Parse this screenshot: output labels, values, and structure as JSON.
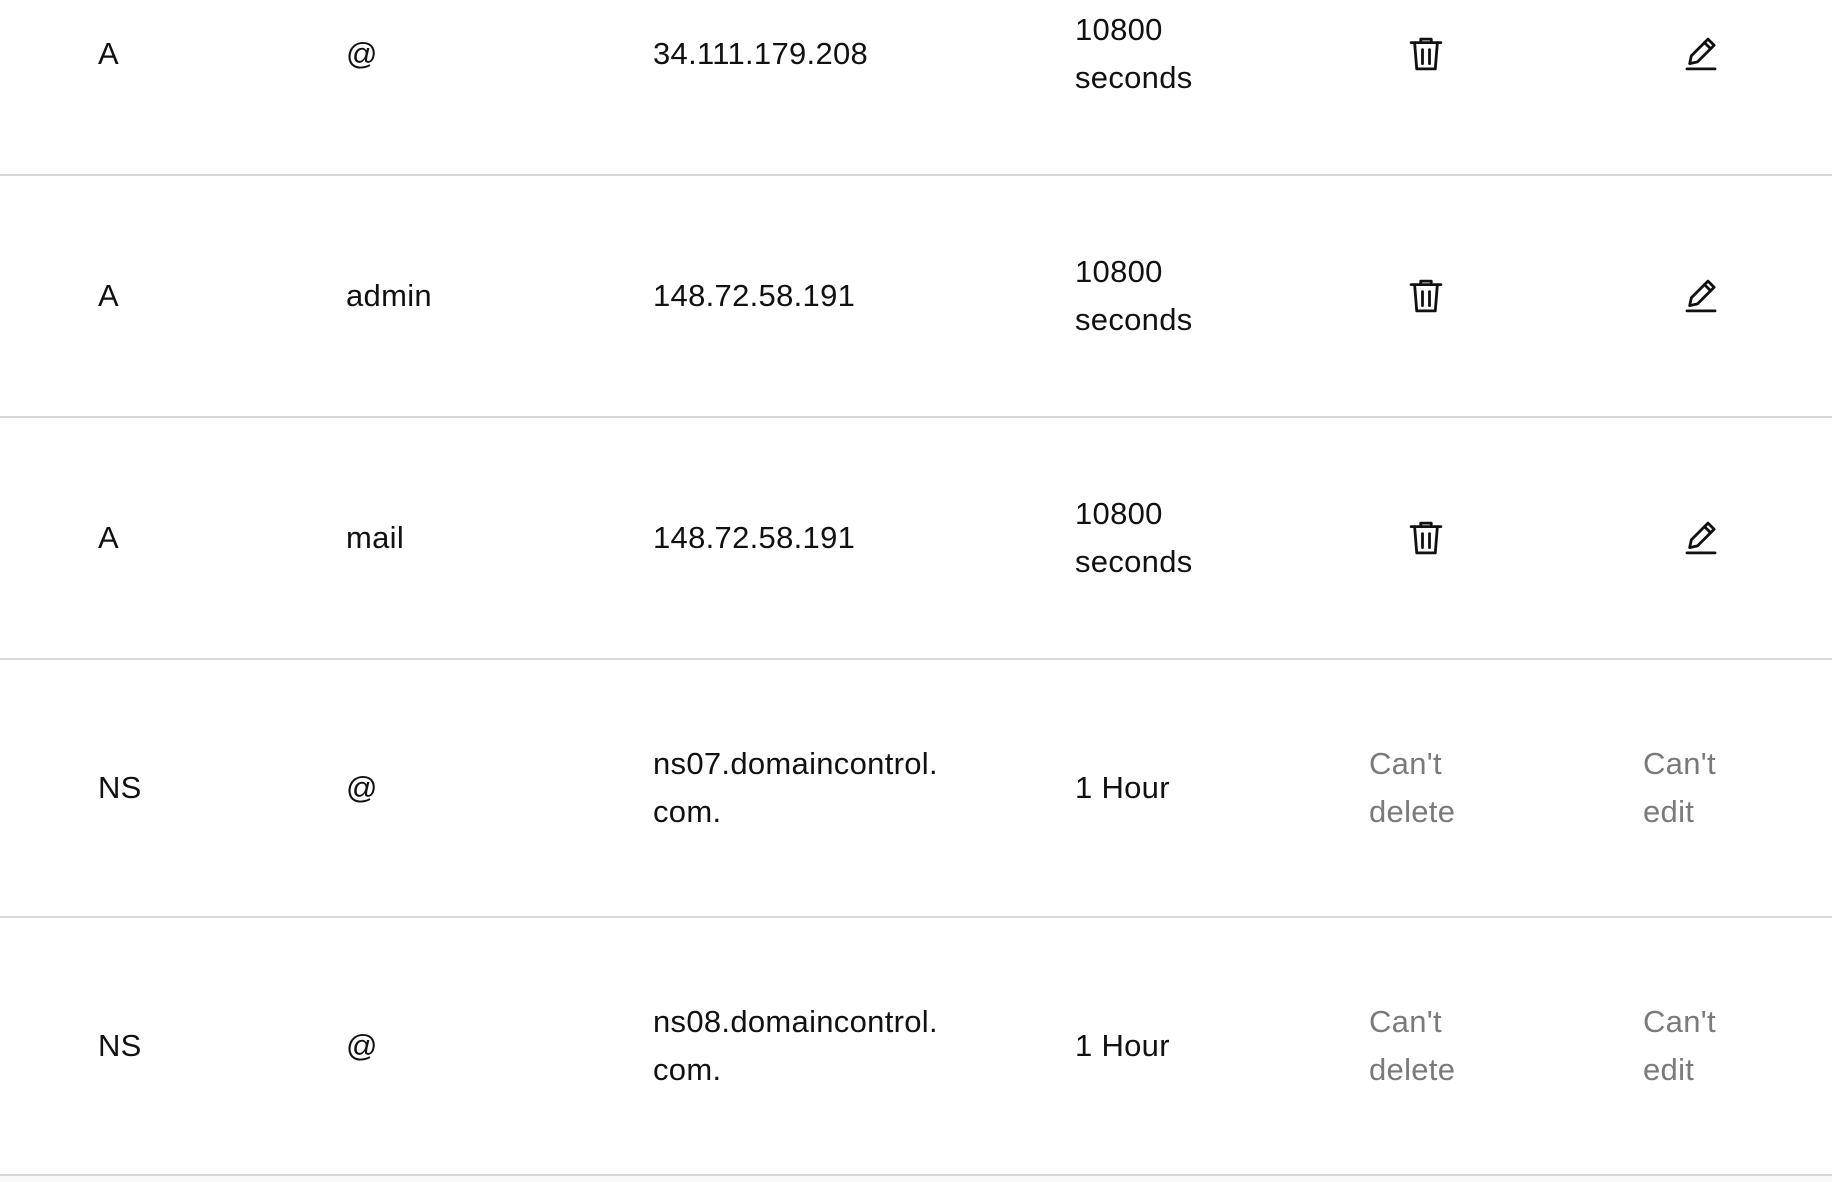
{
  "dns_records": [
    {
      "type": "A",
      "name": "@",
      "data": "34.111.179.208",
      "ttl_line1": "10800",
      "ttl_line2": "seconds",
      "deletable": true,
      "editable": true
    },
    {
      "type": "A",
      "name": "admin",
      "data": "148.72.58.191",
      "ttl_line1": "10800",
      "ttl_line2": "seconds",
      "deletable": true,
      "editable": true
    },
    {
      "type": "A",
      "name": "mail",
      "data": "148.72.58.191",
      "ttl_line1": "10800",
      "ttl_line2": "seconds",
      "deletable": true,
      "editable": true
    },
    {
      "type": "NS",
      "name": "@",
      "data": "ns07.domaincontrol.com.",
      "ttl": "1 Hour",
      "deletable": false,
      "editable": false,
      "delete_line1": "Can't",
      "delete_line2": "delete",
      "edit_line1": "Can't",
      "edit_line2": "edit"
    },
    {
      "type": "NS",
      "name": "@",
      "data": "ns08.domaincontrol.com.",
      "ttl": "1 Hour",
      "deletable": false,
      "editable": false,
      "delete_line1": "Can't",
      "delete_line2": "delete",
      "edit_line1": "Can't",
      "edit_line2": "edit"
    }
  ],
  "icons": {
    "delete": "trash-icon",
    "edit": "pencil-icon"
  },
  "colors": {
    "text": "#111111",
    "muted_text": "#7a7a7a",
    "divider": "#d8d8d8",
    "background": "#ffffff"
  }
}
